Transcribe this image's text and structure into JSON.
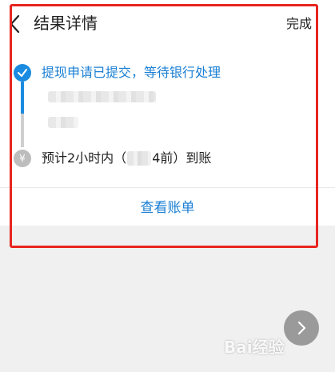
{
  "header": {
    "back_icon": "chevron-left-icon",
    "title": "结果详情",
    "done_label": "完成"
  },
  "timeline": {
    "step1": {
      "icon": "check-icon",
      "status": "提现申请已提交，等待银行处理",
      "color": "#1a8be0"
    },
    "step2": {
      "icon": "yuan-icon",
      "icon_glyph": "¥",
      "prefix": "预计2小时内（",
      "suffix": "4前）到账",
      "color": "#bdbdbd"
    }
  },
  "actions": {
    "view_bill": "查看账单"
  },
  "overlay": {
    "next_icon": "chevron-right-icon",
    "watermark": "Bai经验",
    "highlight_color": "#e8251f"
  }
}
